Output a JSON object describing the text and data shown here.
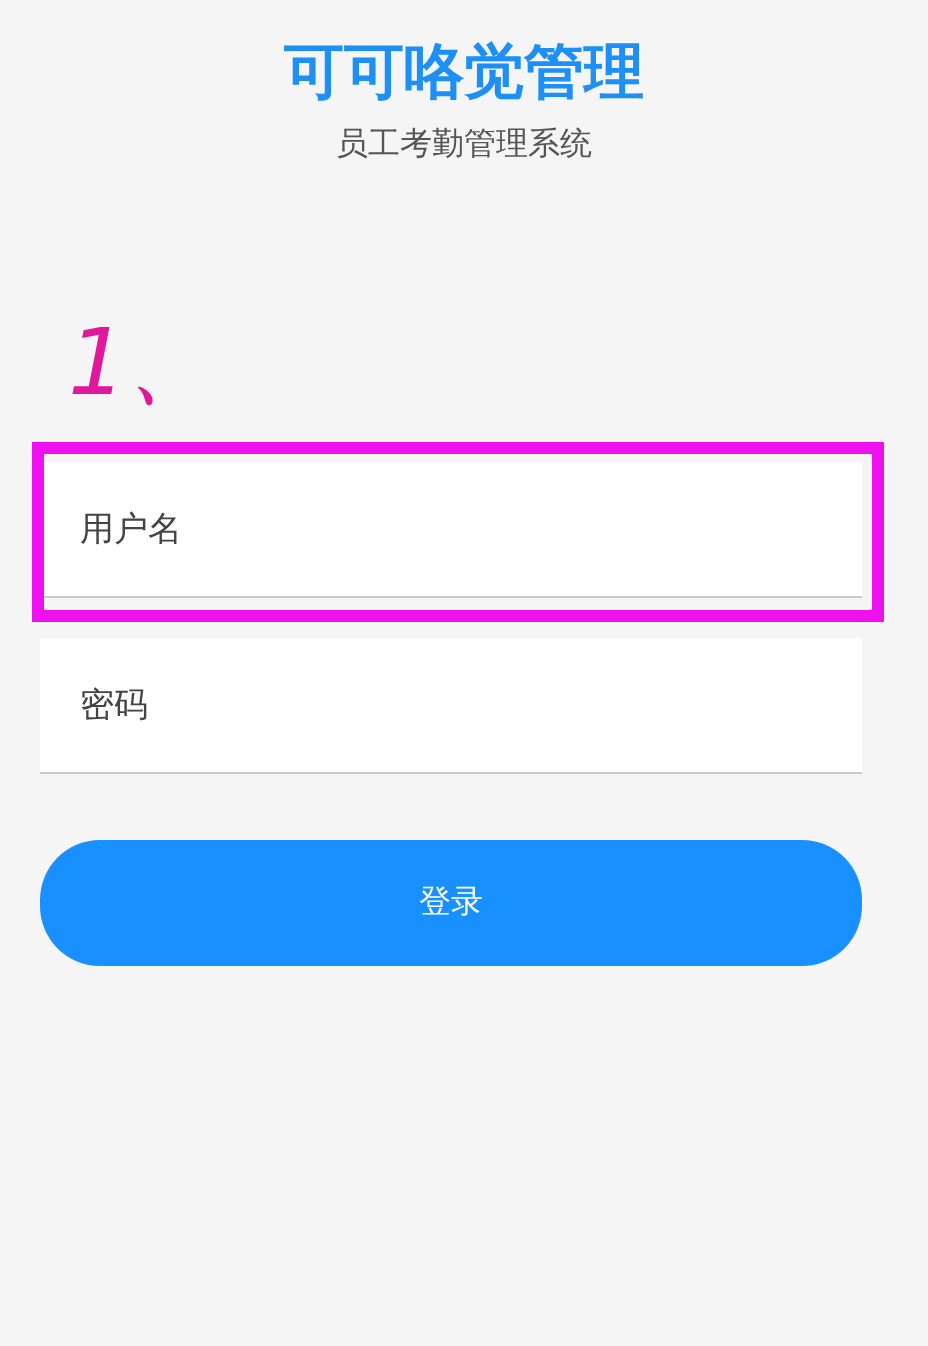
{
  "header": {
    "title": "可可咯觉管理",
    "subtitle": "员工考勤管理系统"
  },
  "annotation": {
    "label": "1、"
  },
  "fields": [
    {
      "placeholder": "用户名",
      "highlighted": true
    },
    {
      "placeholder": "密码",
      "highlighted": false
    }
  ],
  "login_button": {
    "label": "登录"
  }
}
